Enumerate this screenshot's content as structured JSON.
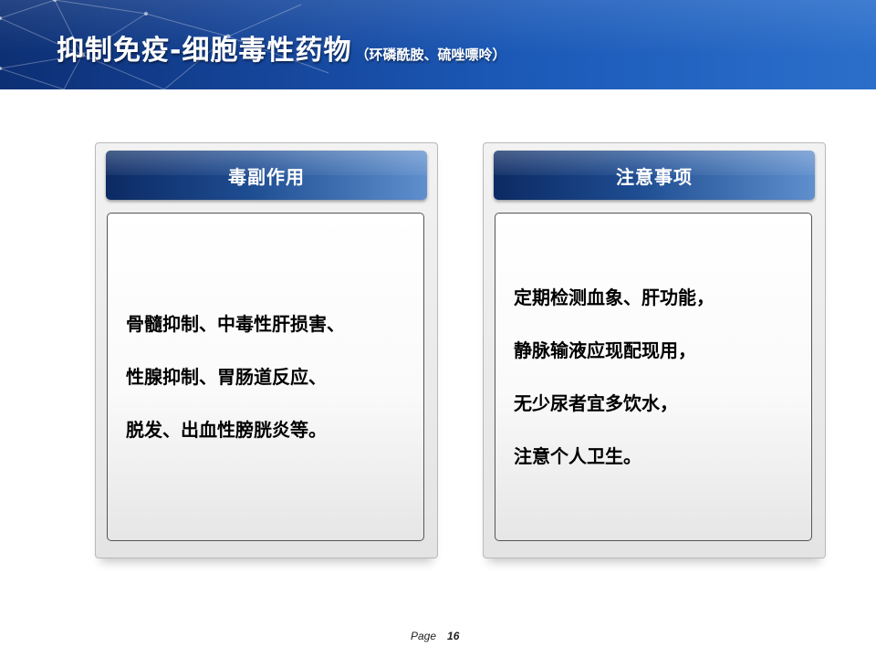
{
  "slide": {
    "title": "抑制免疫-细胞毒性药物",
    "subtitle": "（环磷酰胺、硫唑嘌呤）"
  },
  "panels": {
    "left": {
      "header": "毒副作用",
      "lines": [
        "骨髓抑制、中毒性肝损害、",
        "性腺抑制、胃肠道反应、",
        "脱发、出血性膀胱炎等。"
      ]
    },
    "right": {
      "header": "注意事项",
      "lines": [
        "定期检测血象、肝功能，",
        "静脉输液应现配现用，",
        "无少尿者宜多饮水，",
        "注意个人卫生。"
      ]
    }
  },
  "footer": {
    "page_label": "Page",
    "page_number": "16"
  },
  "colors": {
    "header_band": "#1c5ab8",
    "panel_header_dark": "#0c2a63",
    "panel_header_light": "#5f8fcd",
    "panel_frame": "#e4e4e4"
  }
}
